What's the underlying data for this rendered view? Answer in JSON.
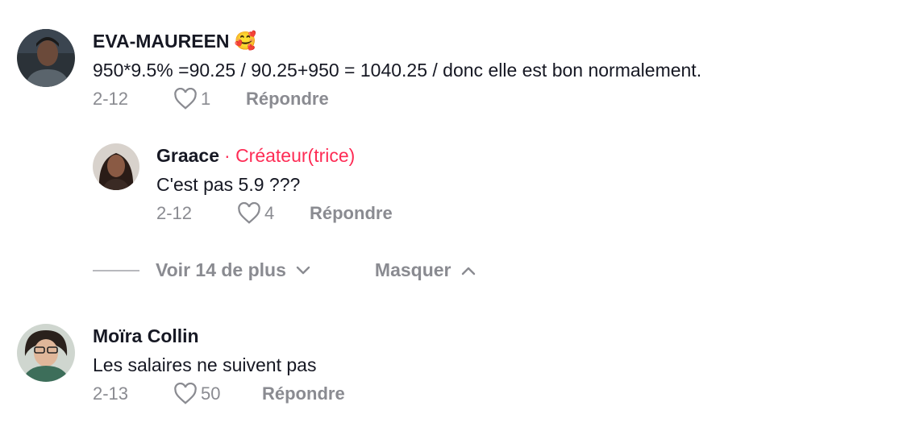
{
  "comments": [
    {
      "author": "EVA-MAUREEN",
      "emoji": "🥰",
      "text": "950*9.5% =90.25 / 90.25+950 = 1040.25 / donc elle est bon normalement.",
      "date": "2-12",
      "likes": "1",
      "reply_label": "Répondre"
    },
    {
      "author": "Graace",
      "badge": "· Créateur(trice)",
      "text": "C'est pas 5.9 ???",
      "date": "2-12",
      "likes": "4",
      "reply_label": "Répondre"
    },
    {
      "author": "Moïra Collin",
      "text": "Les salaires ne suivent pas",
      "date": "2-13",
      "likes": "50",
      "reply_label": "Répondre"
    }
  ],
  "thread": {
    "view_more_label": "Voir 14 de plus",
    "hide_label": "Masquer"
  },
  "colors": {
    "creator_badge": "#fe2c55",
    "meta_gray": "#8a8b91"
  }
}
